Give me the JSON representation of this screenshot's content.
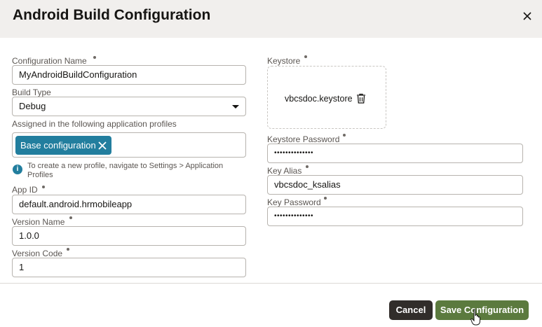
{
  "dialog": {
    "title": "Android Build Configuration",
    "close_icon": "close-icon"
  },
  "form": {
    "config_name": {
      "label": "Configuration Name",
      "value": "MyAndroidBuildConfiguration"
    },
    "build_type": {
      "label": "Build Type",
      "value": "Debug"
    },
    "profiles": {
      "label": "Assigned in the following application profiles",
      "chips": [
        {
          "label": "Base configuration"
        }
      ],
      "help": "To create a new profile, navigate to Settings > Application Profiles"
    },
    "app_id": {
      "label": "App ID",
      "value": "default.android.hrmobileapp"
    },
    "version_name": {
      "label": "Version Name",
      "value": "1.0.0"
    },
    "version_code": {
      "label": "Version Code",
      "value": "1"
    },
    "keystore": {
      "label": "Keystore",
      "file": "vbcsdoc.keystore"
    },
    "keystore_password": {
      "label": "Keystore Password",
      "value": "••••••••••••••"
    },
    "key_alias": {
      "label": "Key Alias",
      "value": "vbcsdoc_ksalias"
    },
    "key_password": {
      "label": "Key Password",
      "value": "••••••••••••••"
    }
  },
  "footer": {
    "cancel_label": "Cancel",
    "save_label": "Save Configuration"
  },
  "colors": {
    "header_bg": "#f1efed",
    "chip": "#227e9e",
    "primary": "#5b7a3e",
    "cancel": "#312d2a"
  }
}
